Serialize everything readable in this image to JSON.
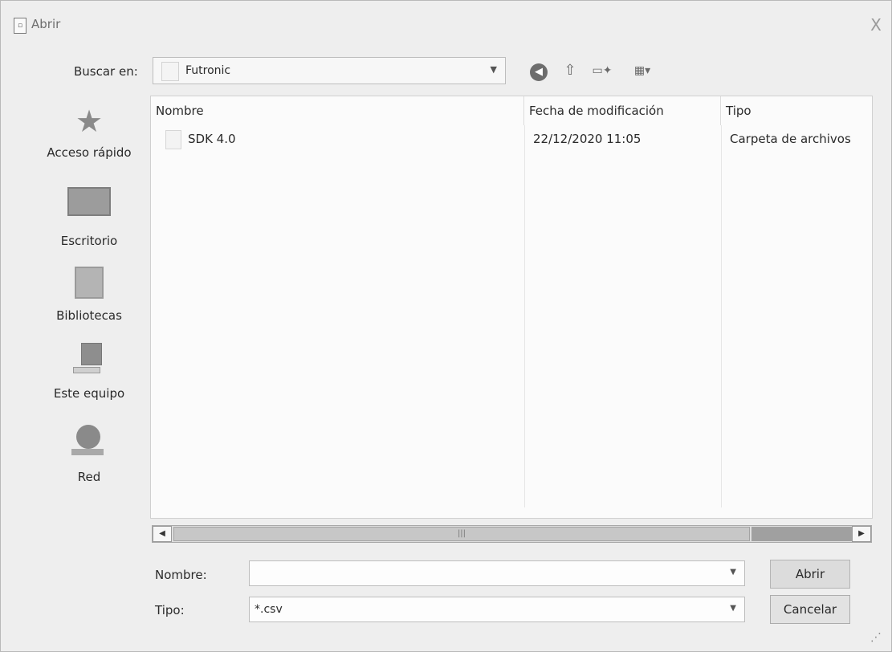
{
  "window": {
    "title": "Abrir",
    "close": "X"
  },
  "lookin": {
    "label": "Buscar en:",
    "value": "Futronic"
  },
  "places": [
    {
      "label": "Acceso rápido",
      "icon": "star-icon"
    },
    {
      "label": "Escritorio",
      "icon": "desktop-icon"
    },
    {
      "label": "Bibliotecas",
      "icon": "libraries-icon"
    },
    {
      "label": "Este equipo",
      "icon": "computer-icon"
    },
    {
      "label": "Red",
      "icon": "network-icon"
    }
  ],
  "filelist": {
    "columns": [
      "Nombre",
      "Fecha de modificación",
      "Tipo"
    ],
    "rows": [
      {
        "name": "SDK 4.0",
        "date": "22/12/2020 11:05",
        "type": "Carpeta de archivos"
      }
    ]
  },
  "form": {
    "name_label": "Nombre:",
    "name_value": "",
    "type_label": "Tipo:",
    "type_value": "*.csv",
    "open_label": "Abrir",
    "cancel_label": "Cancelar"
  }
}
